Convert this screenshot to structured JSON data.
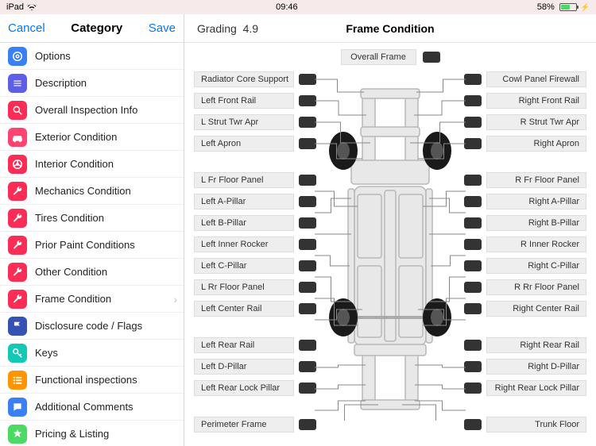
{
  "status": {
    "device": "iPad",
    "time": "09:46",
    "battery": "58%"
  },
  "sidebar": {
    "cancel": "Cancel",
    "save": "Save",
    "title": "Category",
    "items": [
      {
        "label": "Options",
        "icon": "options-icon",
        "color": "c-blue"
      },
      {
        "label": "Description",
        "icon": "description-icon",
        "color": "c-purple"
      },
      {
        "label": "Overall Inspection Info",
        "icon": "inspection-icon",
        "color": "c-red"
      },
      {
        "label": "Exterior Condition",
        "icon": "car-icon",
        "color": "c-pink"
      },
      {
        "label": "Interior Condition",
        "icon": "steering-icon",
        "color": "c-red"
      },
      {
        "label": "Mechanics Condition",
        "icon": "wrench-icon",
        "color": "c-red"
      },
      {
        "label": "Tires Condition",
        "icon": "wrench-icon",
        "color": "c-red"
      },
      {
        "label": "Prior Paint Conditions",
        "icon": "wrench-icon",
        "color": "c-red"
      },
      {
        "label": "Other Condition",
        "icon": "wrench-icon",
        "color": "c-red"
      },
      {
        "label": "Frame Condition",
        "icon": "wrench-icon",
        "color": "c-red",
        "chevron": true
      },
      {
        "label": "Disclosure code / Flags",
        "icon": "flag-icon",
        "color": "c-navy"
      },
      {
        "label": "Keys",
        "icon": "key-icon",
        "color": "c-teal"
      },
      {
        "label": "Functional inspections",
        "icon": "check-icon",
        "color": "c-orange"
      },
      {
        "label": "Additional Comments",
        "icon": "comment-icon",
        "color": "c-blue"
      },
      {
        "label": "Pricing & Listing",
        "icon": "pricing-icon",
        "color": "c-green"
      }
    ]
  },
  "main": {
    "grading_label": "Grading",
    "grading_value": "4.9",
    "title": "Frame Condition",
    "overall_label": "Overall Frame",
    "left_labels": [
      "Radiator Core Support",
      "Left Front Rail",
      "L Strut Twr Apr",
      "Left Apron",
      "",
      "L Fr Floor Panel",
      "Left A-Pillar",
      "Left B-Pillar",
      "Left Inner Rocker",
      "Left C-Pillar",
      "L Rr Floor Panel",
      "Left Center Rail",
      "",
      "Left Rear Rail",
      "Left D-Pillar",
      "Left Rear Lock Pillar",
      "",
      "Perimeter Frame"
    ],
    "right_labels": [
      "Cowl Panel Firewall",
      "Right Front Rail",
      "R Strut Twr Apr",
      "Right Apron",
      "",
      "R Fr Floor Panel",
      "Right A-Pillar",
      "Right B-Pillar",
      "R Inner Rocker",
      "Right C-Pillar",
      "R Rr Floor Panel",
      "Right Center Rail",
      "",
      "Right Rear Rail",
      "Right D-Pillar",
      "Right Rear Lock Pillar",
      "",
      "Trunk Floor"
    ]
  }
}
